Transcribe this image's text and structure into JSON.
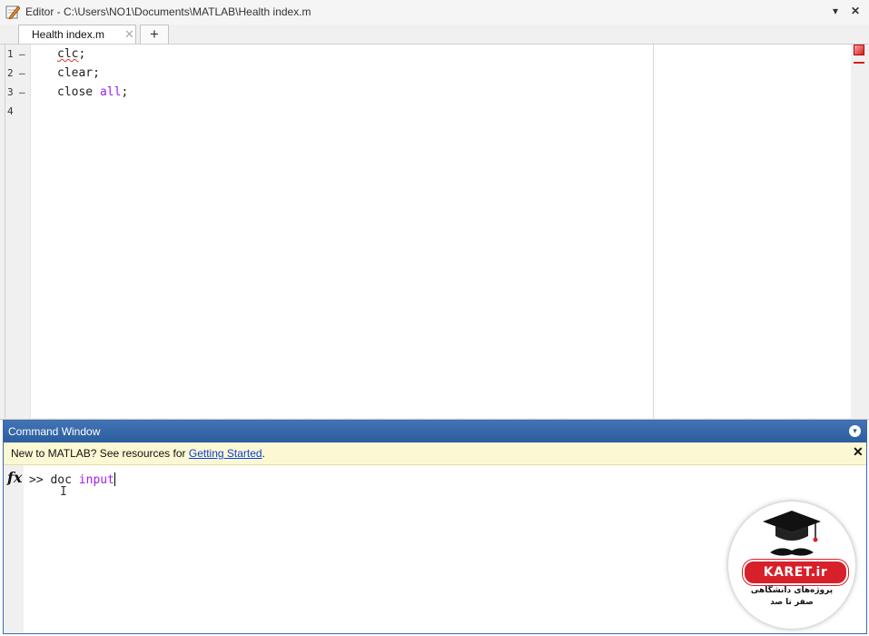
{
  "editor": {
    "title": "Editor - C:\\Users\\NO1\\Documents\\MATLAB\\Health index.m",
    "controls": {
      "menu": "▾",
      "close": "✕"
    },
    "tabs": [
      {
        "label": "Health index.m",
        "close": "✕"
      }
    ],
    "add_tab": "+",
    "lines": [
      {
        "num": "1",
        "bp": "–",
        "plain": "clc",
        "kw": "",
        "end": ";"
      },
      {
        "num": "2",
        "bp": "–",
        "plain": "clear;",
        "kw": "",
        "end": ""
      },
      {
        "num": "3",
        "bp": "–",
        "plain": "close ",
        "kw": "all",
        "end": ";"
      },
      {
        "num": "4",
        "bp": "",
        "plain": "",
        "kw": "",
        "end": ""
      }
    ],
    "colors": {
      "keyword": "#a020f0",
      "status_error": "#d42020"
    }
  },
  "command_window": {
    "title": "Command Window",
    "menu": "▾",
    "banner": {
      "text": "New to MATLAB? See resources for ",
      "link": "Getting Started",
      "suffix": ".",
      "close": "✕"
    },
    "fx": "fx",
    "prompt": ">> ",
    "command": "doc ",
    "argument": "input",
    "cursor_icon": "I"
  },
  "watermark": {
    "brand": "KARET.ir",
    "line1": "پروژه‌های دانشگاهی",
    "line2": "صفر تا صد"
  }
}
